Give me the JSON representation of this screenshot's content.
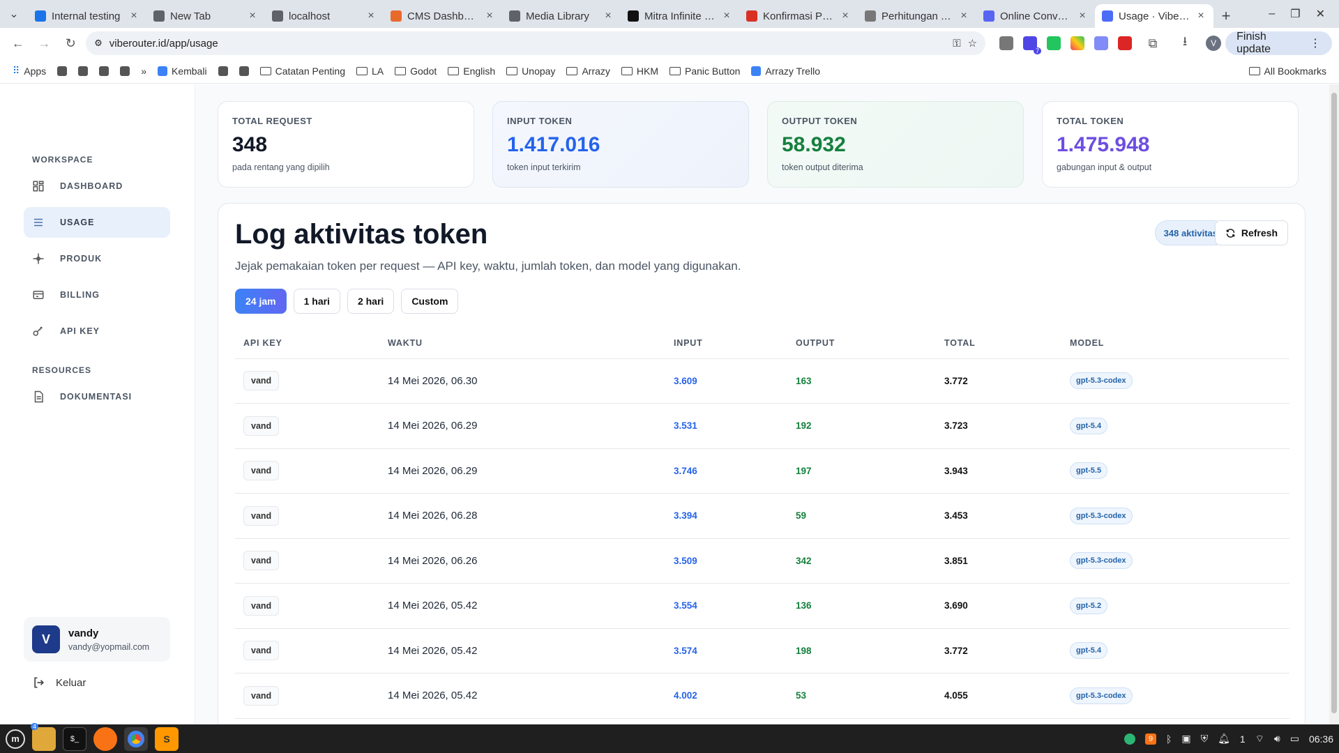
{
  "browser": {
    "tabs": [
      {
        "title": "Internal testing",
        "color": "#1a73e8",
        "active": false
      },
      {
        "title": "New Tab",
        "color": "#5f6368",
        "active": false
      },
      {
        "title": "localhost",
        "color": "#5f6368",
        "active": false
      },
      {
        "title": "CMS Dashboard",
        "color": "#e86a2b",
        "active": false
      },
      {
        "title": "Media Library",
        "color": "#5f6368",
        "active": false
      },
      {
        "title": "Mitra Infinite - E",
        "color": "#111111",
        "active": false
      },
      {
        "title": "Konfirmasi Pemb",
        "color": "#d93025",
        "active": false
      },
      {
        "title": "Perhitungan Tot",
        "color": "#777777",
        "active": false
      },
      {
        "title": "Online Converter",
        "color": "#5865f2",
        "active": false
      },
      {
        "title": "Usage · Viberout",
        "color": "#4a6cf7",
        "active": true
      }
    ],
    "url": "viberouter.id/app/usage",
    "finish_update": "Finish update",
    "profile_initial": "V",
    "ext_badge": "7"
  },
  "bookmarks": {
    "items": [
      {
        "label": "Apps",
        "type": "apps"
      },
      {
        "label": "",
        "type": "sq"
      },
      {
        "label": "",
        "type": "sq"
      },
      {
        "label": "",
        "type": "sq"
      },
      {
        "label": "",
        "type": "sq"
      },
      {
        "label": "»",
        "type": "text"
      },
      {
        "label": "Kembali",
        "type": "link"
      },
      {
        "label": "",
        "type": "sq"
      },
      {
        "label": "",
        "type": "sq"
      },
      {
        "label": "Catatan Penting",
        "type": "folder"
      },
      {
        "label": "LA",
        "type": "folder"
      },
      {
        "label": "Godot",
        "type": "folder"
      },
      {
        "label": "English",
        "type": "folder"
      },
      {
        "label": "Unopay",
        "type": "folder"
      },
      {
        "label": "Arrazy",
        "type": "folder"
      },
      {
        "label": "HKM",
        "type": "folder"
      },
      {
        "label": "Panic Button",
        "type": "folder"
      },
      {
        "label": "Arrazy Trello",
        "type": "link"
      }
    ],
    "all_bookmarks": "All Bookmarks"
  },
  "sidebar": {
    "workspace_label": "WORKSPACE",
    "resources_label": "RESOURCES",
    "items": [
      {
        "label": "DASHBOARD",
        "icon": "grid-icon",
        "active": false
      },
      {
        "label": "USAGE",
        "icon": "menu-icon",
        "active": true
      },
      {
        "label": "PRODUK",
        "icon": "sparkle-icon",
        "active": false
      },
      {
        "label": "BILLING",
        "icon": "wallet-icon",
        "active": false
      },
      {
        "label": "API KEY",
        "icon": "key-icon",
        "active": false
      }
    ],
    "resources": [
      {
        "label": "DOKUMENTASI",
        "icon": "document-icon"
      }
    ],
    "user": {
      "initial": "V",
      "name": "vandy",
      "email": "vandy@yopmail.com"
    },
    "logout": "Keluar"
  },
  "stats": [
    {
      "label": "TOTAL REQUEST",
      "value": "348",
      "sub": "pada rentang yang dipilih",
      "color": "#111827"
    },
    {
      "label": "INPUT TOKEN",
      "value": "1.417.016",
      "sub": "token input terkirim",
      "color": "#2563eb"
    },
    {
      "label": "OUTPUT TOKEN",
      "value": "58.932",
      "sub": "token output diterima",
      "color": "#15803d"
    },
    {
      "label": "TOTAL TOKEN",
      "value": "1.475.948",
      "sub": "gabungan input & output",
      "color": "#6d4ee0"
    }
  ],
  "log": {
    "title": "Log aktivitas token",
    "subtitle": "Jejak pemakaian token per request — API key, waktu, jumlah token, dan model yang digunakan.",
    "count_badge": "348 aktivitas",
    "refresh_label": "Refresh",
    "ranges": [
      "24 jam",
      "1 hari",
      "2 hari",
      "Custom"
    ],
    "active_range": "24 jam",
    "columns": [
      "API KEY",
      "WAKTU",
      "INPUT",
      "OUTPUT",
      "TOTAL",
      "MODEL"
    ],
    "rows": [
      {
        "key": "vand",
        "time": "14 Mei 2026, 06.30",
        "input": "3.609",
        "output": "163",
        "total": "3.772",
        "model": "gpt-5.3-codex"
      },
      {
        "key": "vand",
        "time": "14 Mei 2026, 06.29",
        "input": "3.531",
        "output": "192",
        "total": "3.723",
        "model": "gpt-5.4"
      },
      {
        "key": "vand",
        "time": "14 Mei 2026, 06.29",
        "input": "3.746",
        "output": "197",
        "total": "3.943",
        "model": "gpt-5.5"
      },
      {
        "key": "vand",
        "time": "14 Mei 2026, 06.28",
        "input": "3.394",
        "output": "59",
        "total": "3.453",
        "model": "gpt-5.3-codex"
      },
      {
        "key": "vand",
        "time": "14 Mei 2026, 06.26",
        "input": "3.509",
        "output": "342",
        "total": "3.851",
        "model": "gpt-5.3-codex"
      },
      {
        "key": "vand",
        "time": "14 Mei 2026, 05.42",
        "input": "3.554",
        "output": "136",
        "total": "3.690",
        "model": "gpt-5.2"
      },
      {
        "key": "vand",
        "time": "14 Mei 2026, 05.42",
        "input": "3.574",
        "output": "198",
        "total": "3.772",
        "model": "gpt-5.4"
      },
      {
        "key": "vand",
        "time": "14 Mei 2026, 05.42",
        "input": "4.002",
        "output": "53",
        "total": "4.055",
        "model": "gpt-5.3-codex"
      }
    ]
  },
  "taskbar": {
    "clock": "06:36",
    "files_badge": "4",
    "tray_badge": "9",
    "tray_num": "1"
  }
}
